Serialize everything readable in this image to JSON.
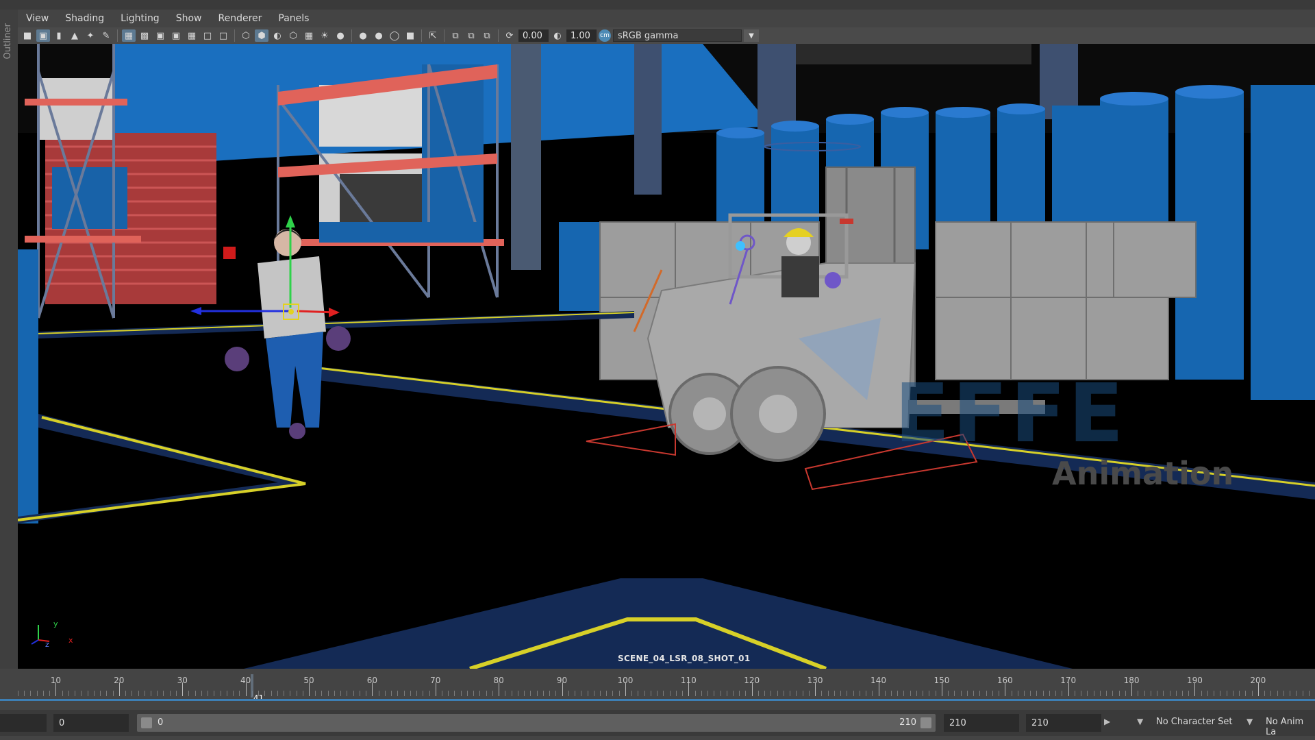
{
  "outliner": {
    "label": "Outliner"
  },
  "menu": [
    "View",
    "Shading",
    "Lighting",
    "Show",
    "Renderer",
    "Panels"
  ],
  "toolbar": {
    "exposure": "0.00",
    "gamma": "1.00",
    "color_management_toggle": "cm",
    "color_space": "sRGB gamma",
    "icons": [
      "select-camera-icon",
      "camera-attributes-icon",
      "bookmark-icon",
      "image-plane-icon",
      "2d-pan-zoom-icon",
      "grease-pencil-icon",
      "grid-icon",
      "film-gate-icon",
      "resolution-gate-icon",
      "gate-mask-icon",
      "field-chart-icon",
      "safe-action-icon",
      "safe-title-icon",
      "wireframe-icon",
      "smooth-shade-icon",
      "default-material-icon",
      "xray-icon",
      "textured-icon",
      "use-lights-icon",
      "shadows-icon",
      "ambient-occlusion-icon",
      "motion-blur-icon",
      "anti-aliasing-icon",
      "depth-of-field-icon",
      "isolate-select-icon",
      "xray-joints-icon",
      "xray-active-icon",
      "backface-cull-icon",
      "exposure-icon",
      "gamma-icon",
      "view-transform-icon"
    ]
  },
  "viewport": {
    "shot_label": "SCENE_04_LSR_08_SHOT_01",
    "watermark_letters": "EFFE",
    "watermark_sub": "Animation",
    "axis": {
      "y": "y",
      "x": "x",
      "z": "z"
    }
  },
  "timeline": {
    "start": 4,
    "end": 209,
    "labeled_ticks": [
      10,
      20,
      30,
      40,
      50,
      60,
      70,
      80,
      90,
      100,
      110,
      120,
      130,
      140,
      150,
      160,
      170,
      180,
      190,
      200
    ],
    "current_frame": "41",
    "current_value": 41
  },
  "range": {
    "left_blank": "",
    "start_time": "0",
    "playback_start": "0",
    "playback_end": "210",
    "end_time": "210",
    "anim_end": "210",
    "character_set": "No Character Set",
    "anim_layer": "No Anim La"
  },
  "colors": {
    "viewport_bg": "#000000",
    "ui_panel": "#444444",
    "accent_blue": "#3d7fb5",
    "rack_red": "#e0635a",
    "barrel_blue": "#1666b0",
    "floor_line_yellow": "#d7d028"
  }
}
